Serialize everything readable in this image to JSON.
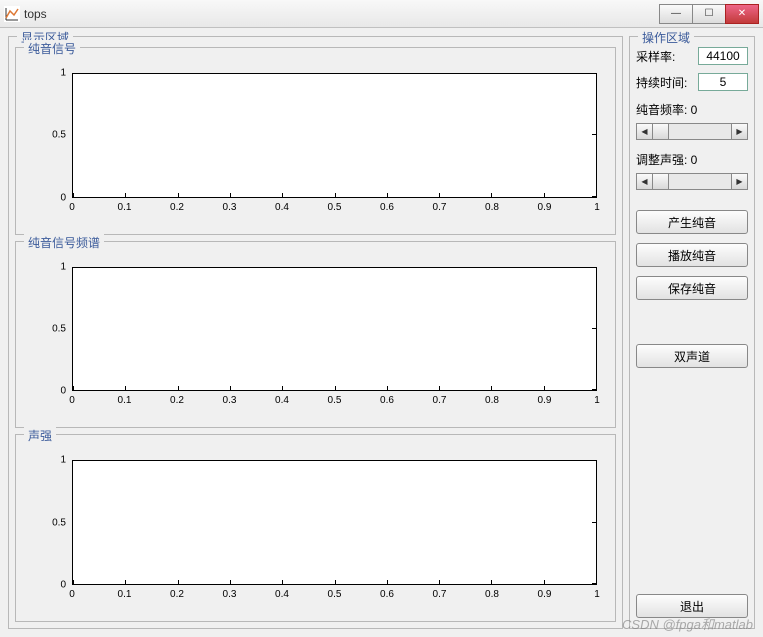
{
  "window": {
    "title": "tops",
    "min": "—",
    "max": "☐",
    "close": "✕"
  },
  "display": {
    "title": "显示区域",
    "charts": [
      {
        "title": "纯音信号"
      },
      {
        "title": "纯音信号频谱"
      },
      {
        "title": "声强"
      }
    ]
  },
  "chart_data": [
    {
      "type": "line",
      "title": "纯音信号",
      "x": [],
      "y": [],
      "xlim": [
        0,
        1
      ],
      "ylim": [
        0,
        1
      ],
      "xticks": [
        0,
        0.1,
        0.2,
        0.3,
        0.4,
        0.5,
        0.6,
        0.7,
        0.8,
        0.9,
        1
      ],
      "yticks": [
        0,
        0.5,
        1
      ]
    },
    {
      "type": "line",
      "title": "纯音信号频谱",
      "x": [],
      "y": [],
      "xlim": [
        0,
        1
      ],
      "ylim": [
        0,
        1
      ],
      "xticks": [
        0,
        0.1,
        0.2,
        0.3,
        0.4,
        0.5,
        0.6,
        0.7,
        0.8,
        0.9,
        1
      ],
      "yticks": [
        0,
        0.5,
        1
      ]
    },
    {
      "type": "line",
      "title": "声强",
      "x": [],
      "y": [],
      "xlim": [
        0,
        1
      ],
      "ylim": [
        0,
        1
      ],
      "xticks": [
        0,
        0.1,
        0.2,
        0.3,
        0.4,
        0.5,
        0.6,
        0.7,
        0.8,
        0.9,
        1
      ],
      "yticks": [
        0,
        0.5,
        1
      ]
    }
  ],
  "ops": {
    "title": "操作区域",
    "sample_rate_label": "采样率:",
    "sample_rate_value": "44100",
    "duration_label": "持续时间:",
    "duration_value": "5",
    "freq_label": "纯音频率: 0",
    "intensity_label": "调整声强: 0",
    "btn_generate": "产生纯音",
    "btn_play": "播放纯音",
    "btn_save": "保存纯音",
    "btn_stereo": "双声道",
    "btn_exit": "退出"
  },
  "watermark": "CSDN @fpga和matlab"
}
